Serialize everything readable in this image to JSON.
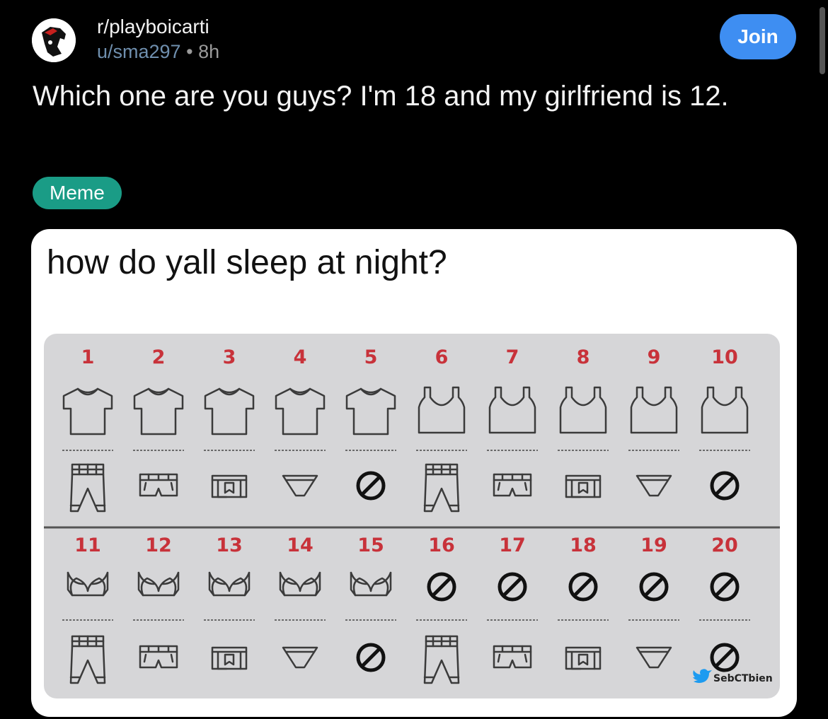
{
  "post": {
    "subreddit": "r/playboicarti",
    "username": "u/sma297",
    "separator": "•",
    "age": "8h",
    "join_label": "Join",
    "title": "Which one are you guys? I'm 18 and my girlfriend is 12.",
    "flair": "Meme"
  },
  "image": {
    "caption": "how do yall sleep at night?",
    "credit": "SebCTbien",
    "rows": [
      {
        "numbers": [
          "1",
          "2",
          "3",
          "4",
          "5",
          "6",
          "7",
          "8",
          "9",
          "10"
        ],
        "top": [
          "tshirt",
          "tshirt",
          "tshirt",
          "tshirt",
          "tshirt",
          "tanktop",
          "tanktop",
          "tanktop",
          "tanktop",
          "tanktop"
        ],
        "bottom": [
          "pants",
          "shorts",
          "boxers",
          "briefs",
          "none",
          "pants",
          "shorts",
          "boxers",
          "briefs",
          "none"
        ]
      },
      {
        "numbers": [
          "11",
          "12",
          "13",
          "14",
          "15",
          "16",
          "17",
          "18",
          "19",
          "20"
        ],
        "top": [
          "bra",
          "bra",
          "bra",
          "bra",
          "bra",
          "none",
          "none",
          "none",
          "none",
          "none"
        ],
        "bottom": [
          "pants",
          "shorts",
          "boxers",
          "briefs",
          "none",
          "pants",
          "shorts",
          "boxers",
          "briefs",
          "none"
        ]
      }
    ],
    "colors": {
      "number": "#c8323a",
      "icon": "#3b3b3b",
      "twitter": "#1d9bf0"
    }
  }
}
